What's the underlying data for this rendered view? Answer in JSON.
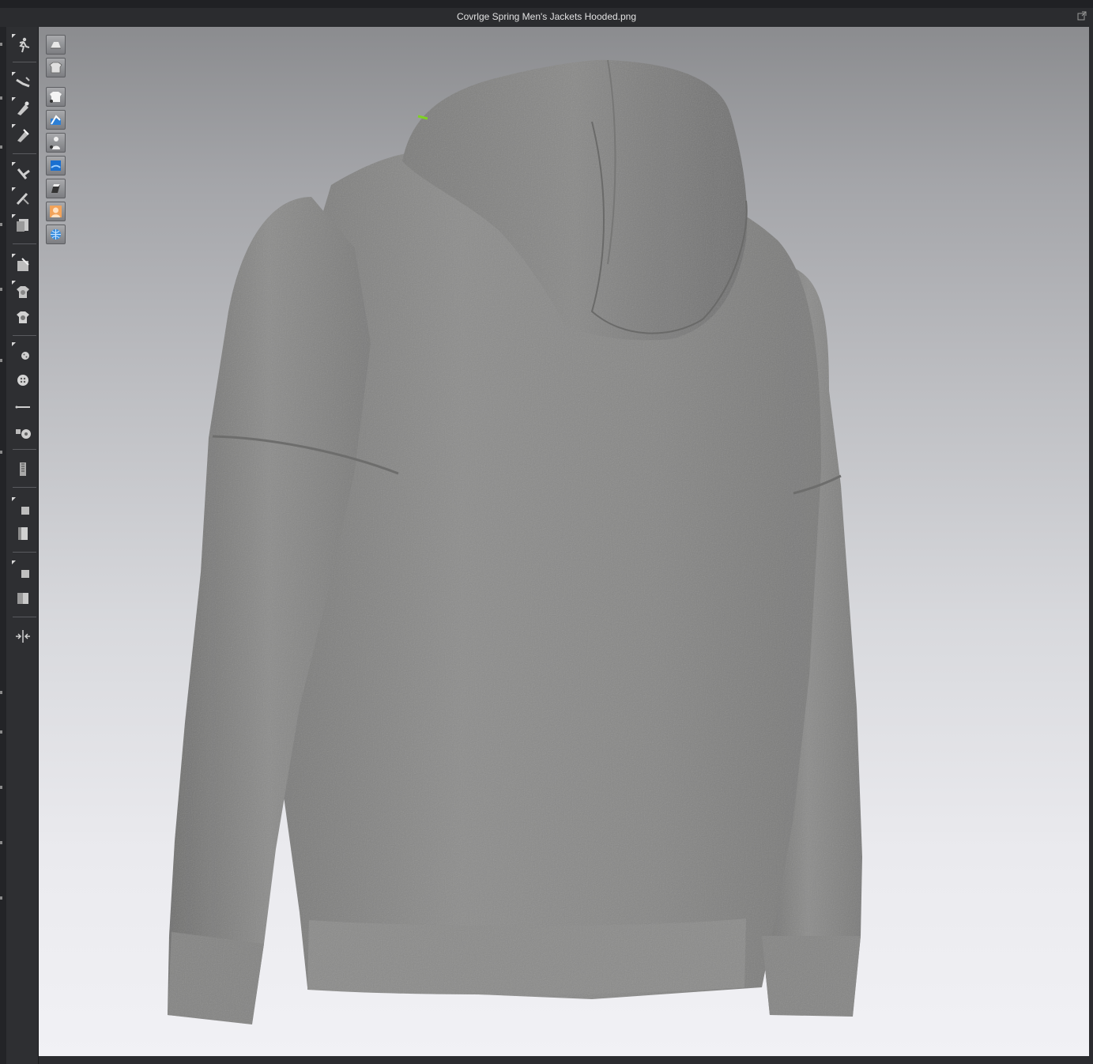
{
  "window": {
    "title": "Covrlge Spring Men's Jackets Hooded.png",
    "popout_icon": "popout-window-icon"
  },
  "left_toolbar": {
    "tools": [
      {
        "name": "avatar-pose-icon"
      },
      {
        "name": "select-mesh-icon"
      },
      {
        "name": "fold-arrangement-icon"
      },
      {
        "name": "tack-icon"
      },
      {
        "name": "transform-pattern-icon"
      },
      {
        "name": "edit-pin-icon"
      },
      {
        "name": "fold-icon"
      },
      {
        "name": "texture-edit-icon"
      },
      {
        "name": "graphic-select-icon"
      },
      {
        "name": "graphic-multi-icon"
      },
      {
        "name": "button-select-icon"
      },
      {
        "name": "button-icon"
      },
      {
        "name": "buttonhole-line-icon"
      },
      {
        "name": "lock-button-icon"
      },
      {
        "name": "zipper-icon"
      },
      {
        "name": "puckering-select-icon"
      },
      {
        "name": "puckering-icon"
      },
      {
        "name": "tape-select-icon"
      },
      {
        "name": "tape-icon"
      },
      {
        "name": "measure-icon"
      }
    ]
  },
  "viewport_toolbar": {
    "buttons": [
      {
        "name": "show-avatar-icon"
      },
      {
        "name": "show-garment-icon"
      },
      {
        "name": "garment-view-icon"
      },
      {
        "name": "avatar-edit-view-icon"
      },
      {
        "name": "show-avatar-view-icon"
      },
      {
        "name": "fabric-thickness-icon"
      },
      {
        "name": "surface-render-icon"
      },
      {
        "name": "avatar-skin-icon"
      },
      {
        "name": "mesh-globe-icon"
      }
    ]
  },
  "scene": {
    "subject": "gray-hooded-sweatshirt",
    "fabric_color": "#8a8a89",
    "background_top": "#8b8c8f",
    "background_bottom": "#f1f1f5",
    "highlight_color": "#7ed321"
  }
}
